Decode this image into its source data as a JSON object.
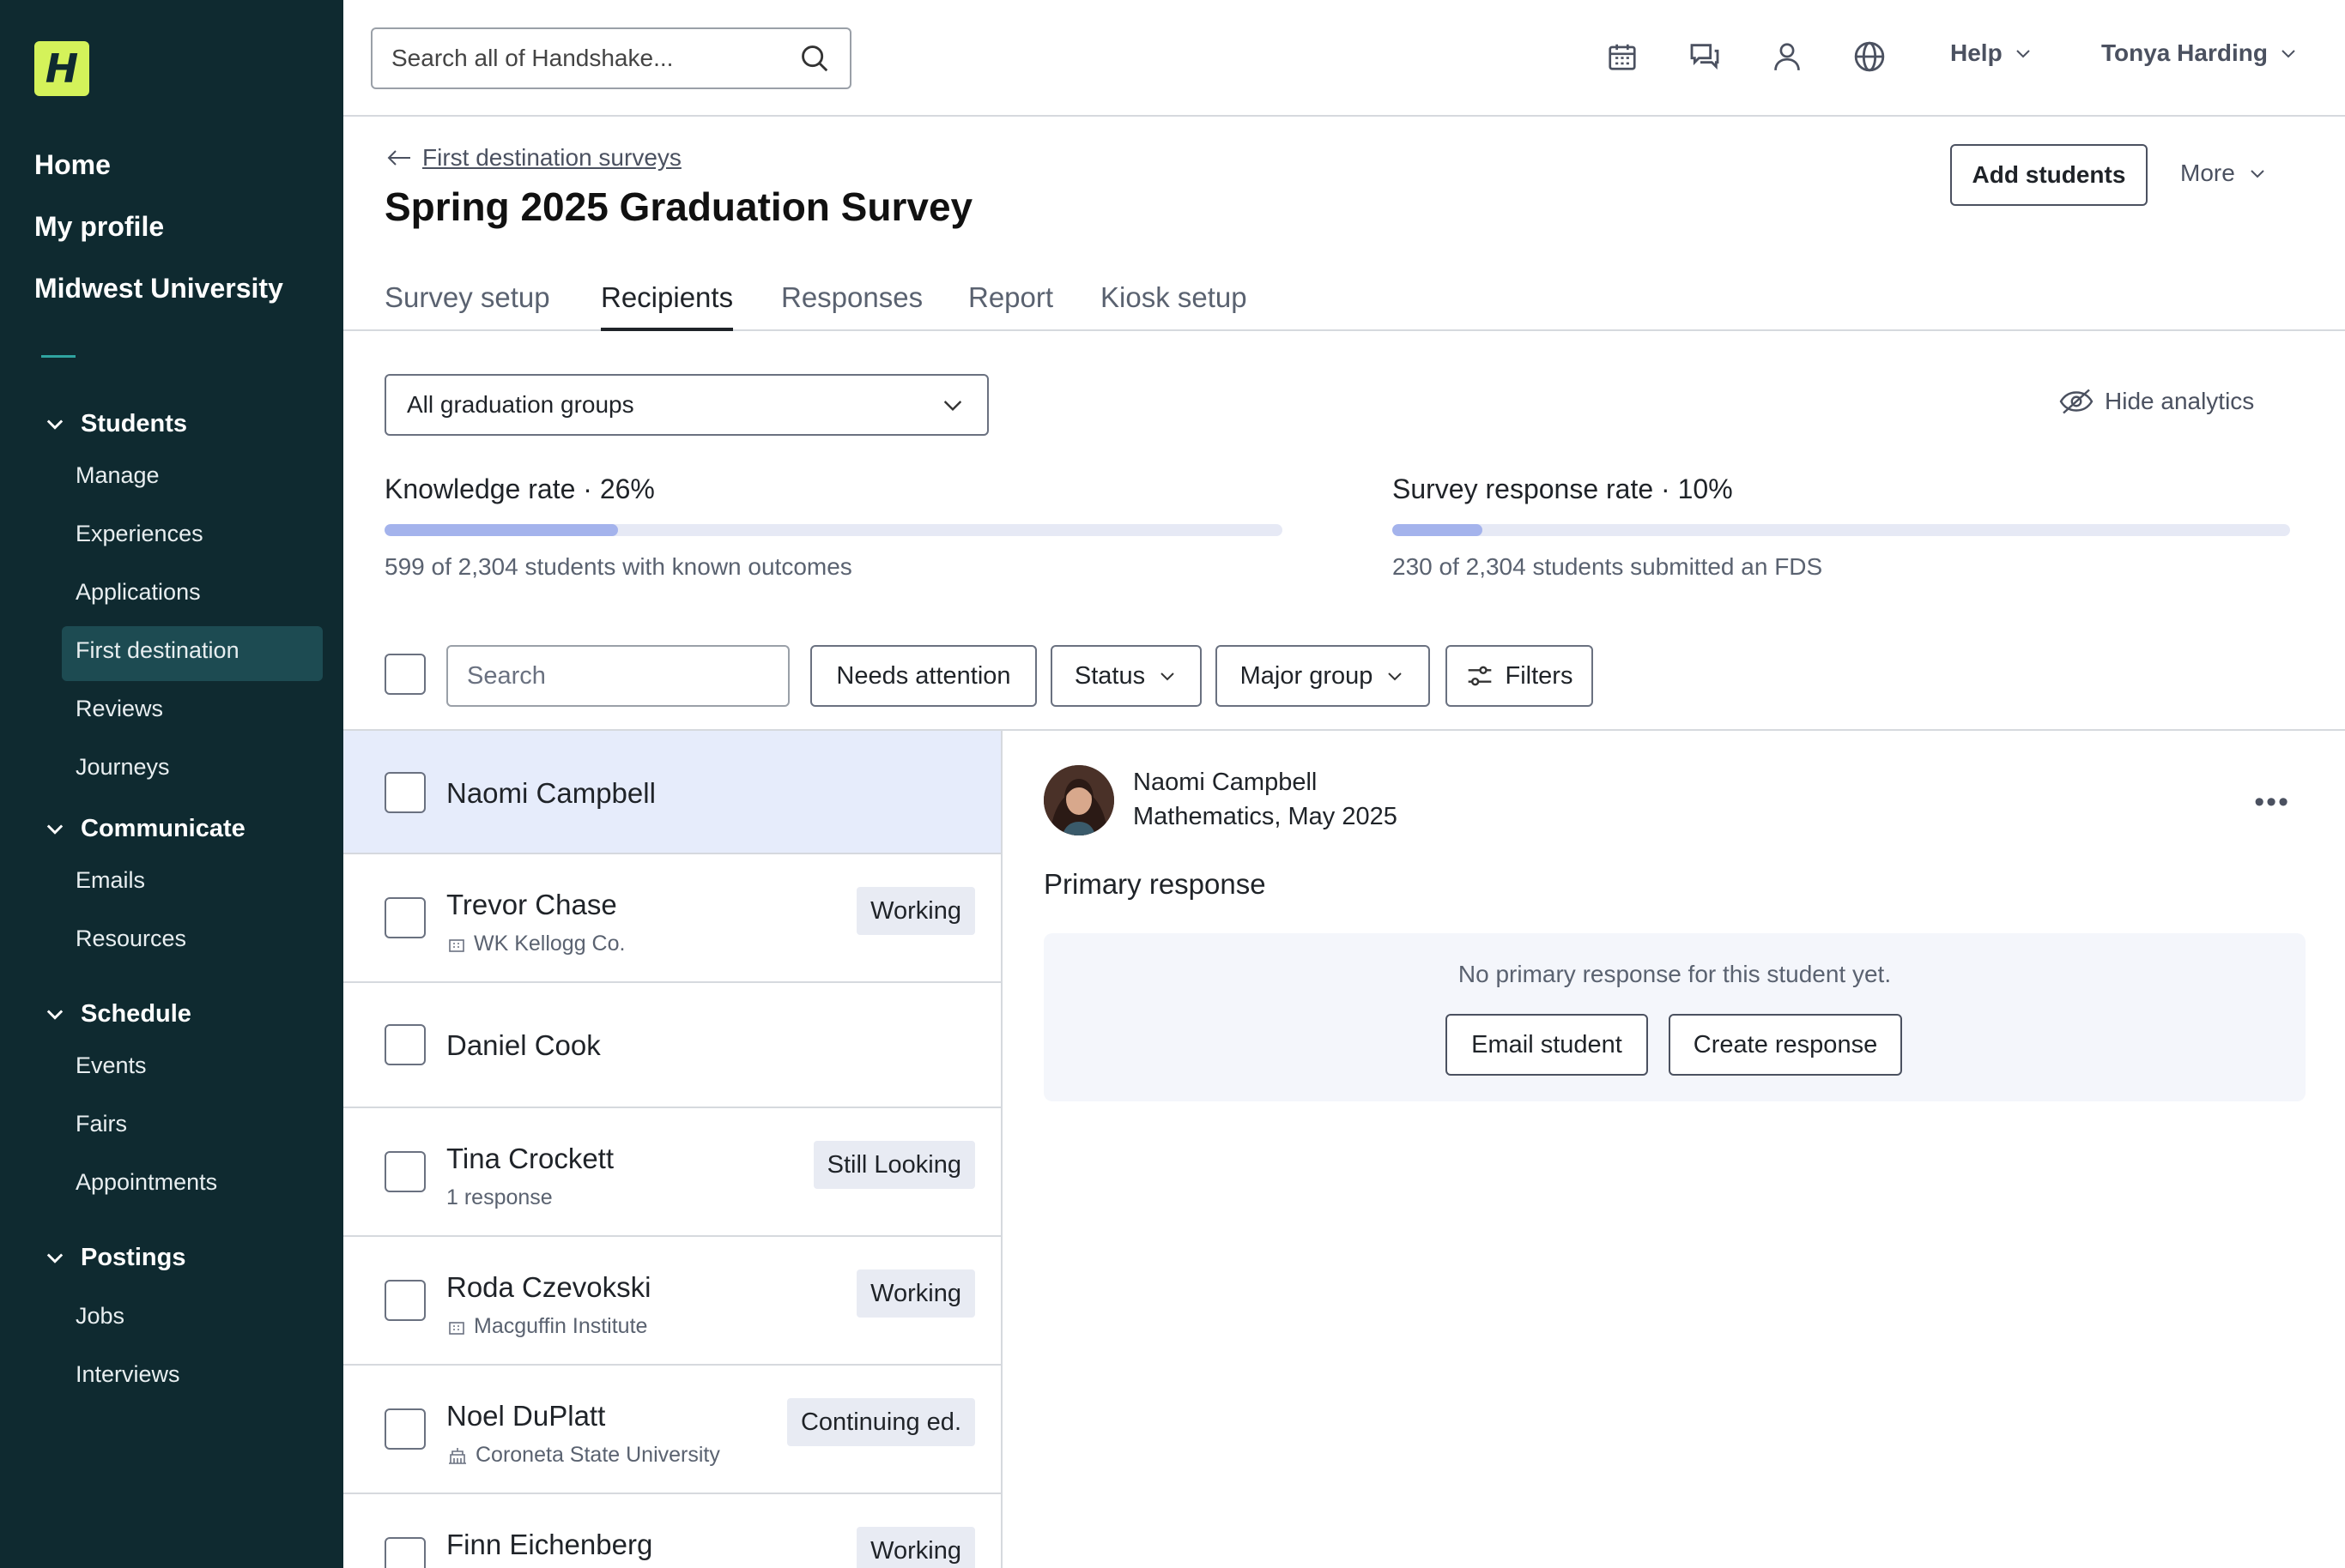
{
  "brand": {
    "logo_letter": "H",
    "logo_color": "#d4f25a"
  },
  "sidebar": {
    "top_links": [
      "Home",
      "My profile",
      "Midwest University"
    ],
    "sections": [
      {
        "title": "Students",
        "items": [
          "Manage",
          "Experiences",
          "Applications",
          "First destination",
          "Reviews",
          "Journeys"
        ],
        "active": "First destination"
      },
      {
        "title": "Communicate",
        "items": [
          "Emails",
          "Resources"
        ]
      },
      {
        "title": "Schedule",
        "items": [
          "Events",
          "Fairs",
          "Appointments"
        ]
      },
      {
        "title": "Postings",
        "items": [
          "Jobs",
          "Interviews"
        ]
      }
    ],
    "bg_color": "#0f2a30"
  },
  "topbar": {
    "search_placeholder": "Search all of Handshake...",
    "icons": [
      "calendar-icon",
      "messages-icon",
      "person-icon",
      "globe-icon"
    ],
    "help_label": "Help",
    "user_name": "Tonya Harding"
  },
  "header": {
    "breadcrumb": "First destination surveys",
    "title": "Spring 2025 Graduation Survey",
    "add_students_label": "Add students",
    "more_label": "More"
  },
  "tabs": [
    "Survey setup",
    "Recipients",
    "Responses",
    "Report",
    "Kiosk setup"
  ],
  "active_tab": "Recipients",
  "analytics": {
    "group_select": "All graduation groups",
    "hide_label": "Hide analytics",
    "knowledge": {
      "label": "Knowledge rate · 26%",
      "fraction": 0.26,
      "sub": "599 of 2,304 students with known outcomes"
    },
    "response": {
      "label": "Survey response rate · 10%",
      "fraction": 0.1,
      "sub": "230 of 2,304 students submitted an FDS"
    }
  },
  "filters": {
    "search_placeholder": "Search",
    "needs_attention": "Needs attention",
    "status": "Status",
    "major_group": "Major group",
    "filters": "Filters"
  },
  "students": [
    {
      "name": "Naomi Campbell",
      "meta": "",
      "badge": "",
      "selected": true
    },
    {
      "name": "Trevor Chase",
      "meta": "WK Kellogg Co.",
      "badge": "Working"
    },
    {
      "name": "Daniel Cook",
      "meta": "",
      "badge": ""
    },
    {
      "name": "Tina Crockett",
      "meta": "1 response",
      "badge": "Still Looking"
    },
    {
      "name": "Roda Czevokski",
      "meta": "Macguffin Institute",
      "badge": "Working"
    },
    {
      "name": "Noel DuPlatt",
      "meta": "Coroneta State University",
      "badge": "Continuing ed."
    },
    {
      "name": "Finn Eichenberg",
      "meta": "",
      "badge": "Working"
    }
  ],
  "detail": {
    "name": "Naomi Campbell",
    "subtitle": "Mathematics, May 2025",
    "primary_title": "Primary response",
    "empty_message": "No primary response for this student yet.",
    "email_label": "Email student",
    "create_label": "Create response"
  }
}
